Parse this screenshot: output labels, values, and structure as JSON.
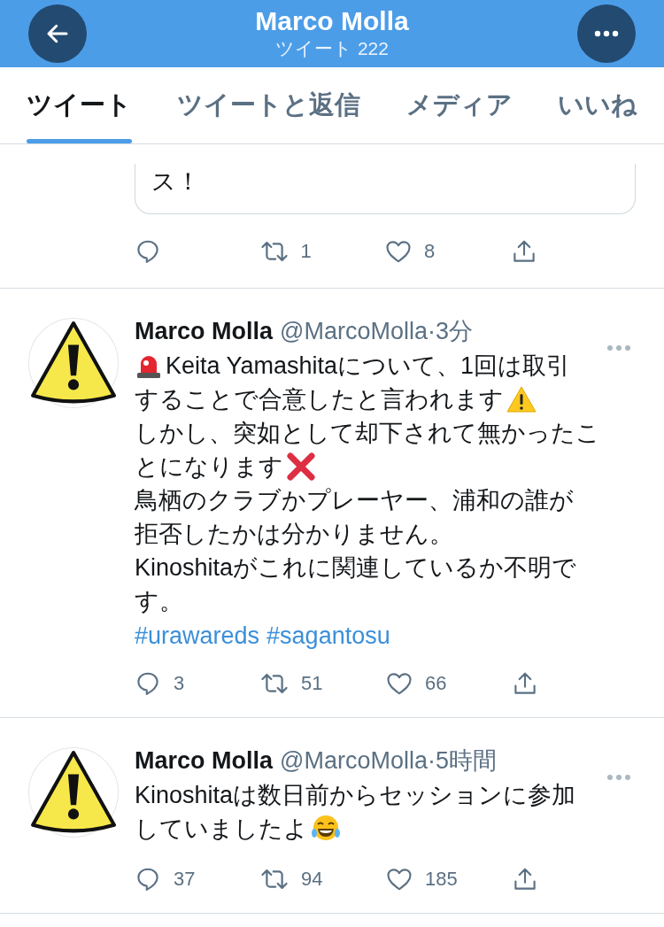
{
  "header": {
    "title": "Marco Molla",
    "subtitle": "ツイート 222"
  },
  "tabs": [
    {
      "label": "ツイート",
      "selected": true
    },
    {
      "label": "ツイートと返信",
      "selected": false
    },
    {
      "label": "メディア",
      "selected": false
    },
    {
      "label": "いいね",
      "selected": false
    }
  ],
  "tweets": [
    {
      "kind": "partial",
      "card_text": "ス！",
      "actions": [
        {
          "kind": "reply"
        },
        {
          "kind": "retweet",
          "count": "1"
        },
        {
          "kind": "like",
          "count": "8"
        },
        {
          "kind": "share"
        }
      ]
    },
    {
      "kind": "full",
      "name": "Marco Molla",
      "handle": "@MarcoMolla",
      "separator": "·",
      "time": "3分",
      "body": [
        [
          {
            "kind": "siren"
          },
          {
            "kind": "text",
            "text": "Keita Yamashitaについて、1回は取引"
          }
        ],
        [
          {
            "kind": "text",
            "text": "することで合意したと言われます"
          },
          {
            "kind": "warning"
          }
        ],
        [
          {
            "kind": "text",
            "text": "しかし、突如として却下されて無かったこ"
          }
        ],
        [
          {
            "kind": "text",
            "text": "とになります"
          },
          {
            "kind": "cross"
          }
        ],
        [
          {
            "kind": "text",
            "text": "鳥栖のクラブかプレーヤー、浦和の誰が"
          }
        ],
        [
          {
            "kind": "text",
            "text": "拒否したかは分かりません。"
          }
        ],
        [
          {
            "kind": "text",
            "text": "Kinoshitaがこれに関連しているか不明で"
          }
        ],
        [
          {
            "kind": "text",
            "text": "す。"
          }
        ]
      ],
      "hashtags": [
        "#urawareds",
        "#sagantosu"
      ],
      "actions": [
        {
          "kind": "reply",
          "count": "3"
        },
        {
          "kind": "retweet",
          "count": "51"
        },
        {
          "kind": "like",
          "count": "66"
        },
        {
          "kind": "share"
        }
      ]
    },
    {
      "kind": "full",
      "name": "Marco Molla",
      "handle": "@MarcoMolla",
      "separator": "·",
      "time": "5時間",
      "body": [
        [
          {
            "kind": "text",
            "text": "Kinoshitaは数日前からセッションに参加"
          }
        ],
        [
          {
            "kind": "text",
            "text": "していましたよ"
          },
          {
            "kind": "laugh"
          }
        ]
      ],
      "actions": [
        {
          "kind": "reply",
          "count": "37"
        },
        {
          "kind": "retweet",
          "count": "94"
        },
        {
          "kind": "like",
          "count": "185"
        },
        {
          "kind": "share"
        }
      ]
    }
  ]
}
